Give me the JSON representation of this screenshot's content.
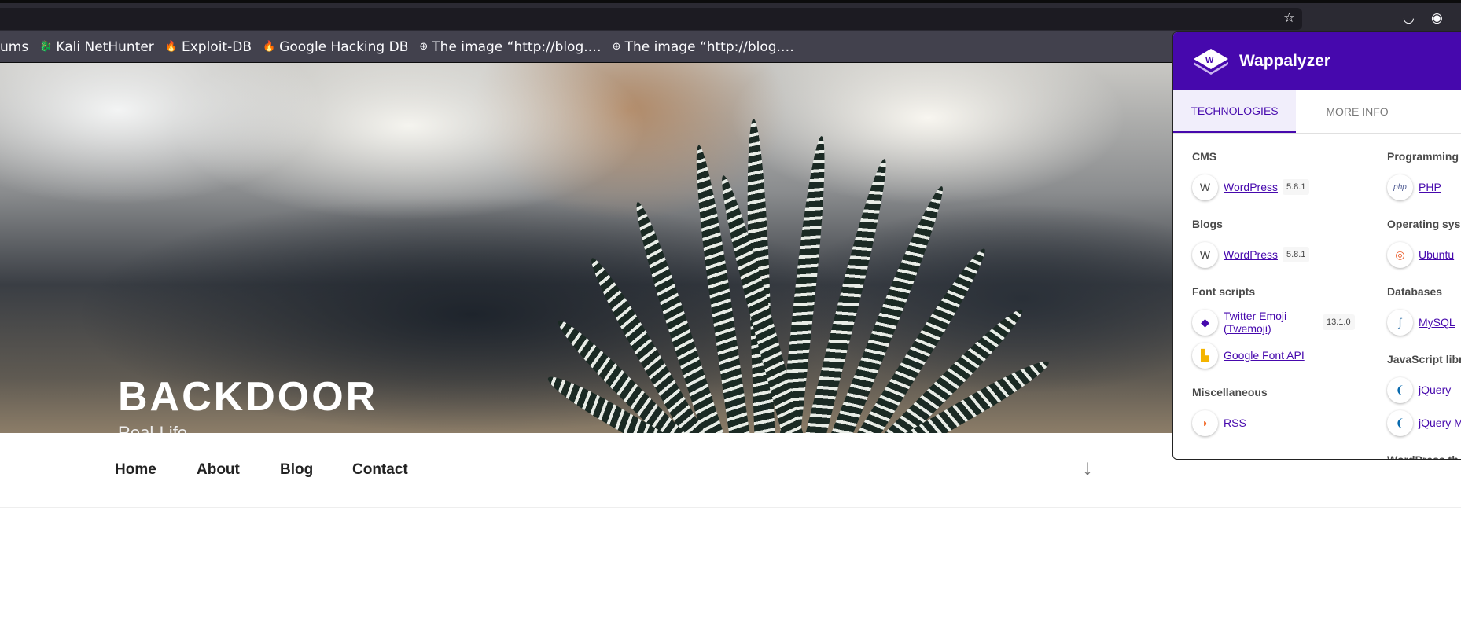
{
  "browser": {
    "bookmarks": [
      {
        "label": "ums",
        "icon": "none"
      },
      {
        "label": "Kali NetHunter",
        "icon": "kali-icon"
      },
      {
        "label": "Exploit-DB",
        "icon": "exploit-db-icon"
      },
      {
        "label": "Google Hacking DB",
        "icon": "exploit-db-icon"
      },
      {
        "label": "The image “http://blog.…",
        "icon": "globe-icon"
      },
      {
        "label": "The image “http://blog.…",
        "icon": "globe-icon"
      }
    ]
  },
  "site": {
    "title": "BACKDOOR",
    "description": "Real-Life",
    "nav": [
      "Home",
      "About",
      "Blog",
      "Contact"
    ]
  },
  "wappalyzer": {
    "name": "Wappalyzer",
    "tabs": [
      "TECHNOLOGIES",
      "MORE INFO"
    ],
    "left": [
      {
        "category": "CMS",
        "items": [
          {
            "name": "WordPress",
            "version": "5.8.1",
            "icon": "wordpress-icon"
          }
        ]
      },
      {
        "category": "Blogs",
        "items": [
          {
            "name": "WordPress",
            "version": "5.8.1",
            "icon": "wordpress-icon"
          }
        ]
      },
      {
        "category": "Font scripts",
        "items": [
          {
            "name": "Twitter Emoji (Twemoji)",
            "version": "13.1.0",
            "icon": "twemoji-icon"
          },
          {
            "name": "Google Font API",
            "version": "",
            "icon": "google-font-icon"
          }
        ]
      },
      {
        "category": "Miscellaneous",
        "items": [
          {
            "name": "RSS",
            "version": "",
            "icon": "rss-icon"
          }
        ]
      }
    ],
    "right": [
      {
        "category": "Programming",
        "items": [
          {
            "name": "PHP",
            "version": "",
            "icon": "php-icon"
          }
        ]
      },
      {
        "category": "Operating sys",
        "items": [
          {
            "name": "Ubuntu",
            "version": "",
            "icon": "ubuntu-icon"
          }
        ]
      },
      {
        "category": "Databases",
        "items": [
          {
            "name": "MySQL",
            "version": "",
            "icon": "mysql-icon"
          }
        ]
      },
      {
        "category": "JavaScript libr",
        "items": [
          {
            "name": "jQuery",
            "version": "",
            "icon": "jquery-icon"
          },
          {
            "name": "jQuery M",
            "version": "",
            "icon": "jquery-icon"
          }
        ]
      },
      {
        "category": "WordPress th",
        "items": []
      }
    ]
  }
}
